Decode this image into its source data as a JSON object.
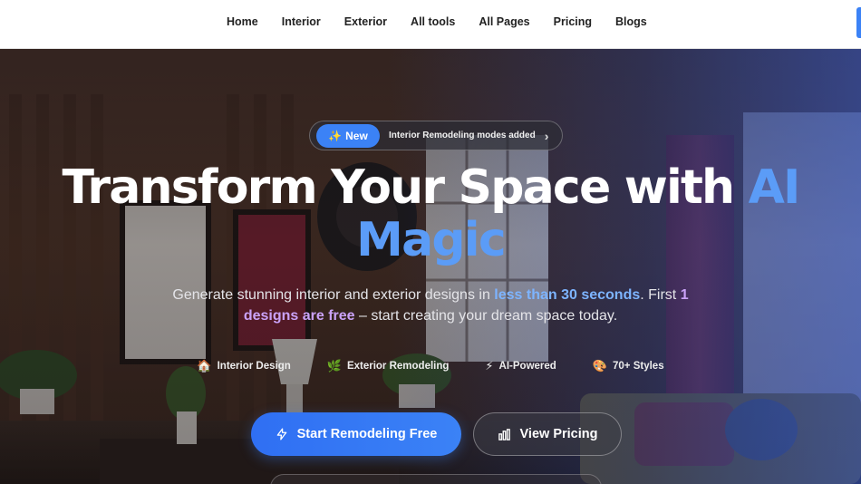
{
  "nav": {
    "items": [
      {
        "label": "Home"
      },
      {
        "label": "Interior"
      },
      {
        "label": "Exterior"
      },
      {
        "label": "All tools"
      },
      {
        "label": "All Pages"
      },
      {
        "label": "Pricing"
      },
      {
        "label": "Blogs"
      }
    ]
  },
  "announcement": {
    "badge_icon": "sparkles-icon",
    "badge_label": "New",
    "text": "Interior Remodeling modes added",
    "chevron": "›"
  },
  "hero": {
    "title_line1": "Transform Your Space with ",
    "title_ai": "AI",
    "title_line2": "Magic",
    "sub_1": "Generate stunning interior and exterior designs in ",
    "sub_hl1": "less than 30 seconds",
    "sub_2": ". First ",
    "sub_hl2": "1 designs are free",
    "sub_3": " – start creating your dream space today."
  },
  "features": [
    {
      "icon": "house-icon",
      "glyph": "🏠",
      "label": "Interior Design"
    },
    {
      "icon": "leaf-icon",
      "glyph": "🌿",
      "label": "Exterior Remodeling"
    },
    {
      "icon": "lightning-icon",
      "glyph": "⚡",
      "label": "AI-Powered"
    },
    {
      "icon": "palette-icon",
      "glyph": "🎨",
      "label": "70+ Styles"
    }
  ],
  "cta": {
    "primary_label": "Start Remodeling Free",
    "primary_icon": "zap-icon",
    "secondary_label": "View Pricing",
    "secondary_icon": "bar-chart-icon"
  },
  "colors": {
    "accent_blue": "#3b82f6",
    "ai_text_blue": "#5b9cf7",
    "highlight_blue": "#7db4ff",
    "highlight_purple": "#caa2f8"
  }
}
